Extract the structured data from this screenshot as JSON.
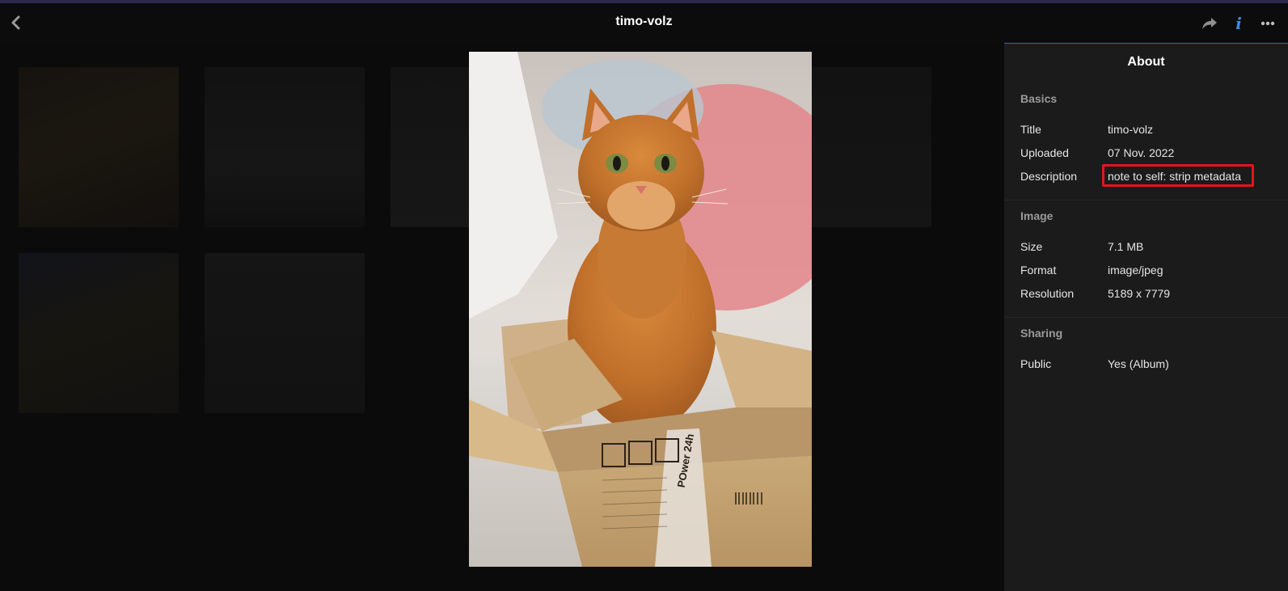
{
  "header": {
    "title": "timo-volz",
    "back_icon": "chevron-left-icon",
    "actions": [
      {
        "name": "share",
        "icon": "share-arrow-icon"
      },
      {
        "name": "info",
        "icon": "info-icon",
        "glyph": "i",
        "color": "#3b8de0"
      },
      {
        "name": "more",
        "icon": "more-horizontal-icon"
      }
    ]
  },
  "photo": {
    "subject": "orange cat sitting in a cardboard box",
    "box_print": "POwer 24h"
  },
  "about_panel": {
    "title": "About",
    "accent_color": "#2e6bb3",
    "sections": [
      {
        "heading": "Basics",
        "rows": [
          {
            "label": "Title",
            "value": "timo-volz"
          },
          {
            "label": "Uploaded",
            "value": "07 Nov. 2022"
          },
          {
            "label": "Description",
            "value": "note to self: strip metadata",
            "highlighted": true,
            "highlight_color": "#e4141b"
          }
        ]
      },
      {
        "heading": "Image",
        "rows": [
          {
            "label": "Size",
            "value": "7.1 MB"
          },
          {
            "label": "Format",
            "value": "image/jpeg"
          },
          {
            "label": "Resolution",
            "value": "5189 x 7779"
          }
        ]
      },
      {
        "heading": "Sharing",
        "rows": [
          {
            "label": "Public",
            "value": "Yes (Album)"
          }
        ]
      }
    ]
  }
}
